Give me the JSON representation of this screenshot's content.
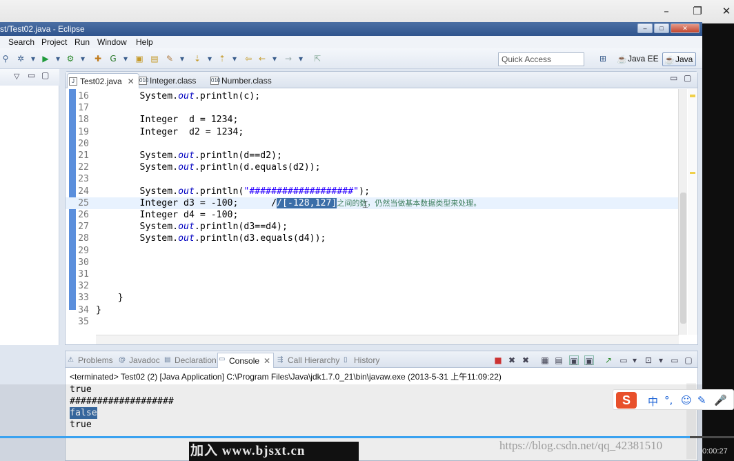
{
  "player": {
    "minimize_icon": "minimize-icon",
    "restore_icon": "restore-icon",
    "close_icon": "close-icon",
    "time": "0:00:27",
    "progress": 0.94
  },
  "window": {
    "title": "st/Test02.java - Eclipse"
  },
  "menu": [
    "Search",
    "Project",
    "Run",
    "Window",
    "Help"
  ],
  "toolbar": {
    "quick_access": "Quick Access",
    "perspectives": [
      "Java EE",
      "Java"
    ]
  },
  "editor": {
    "tabs": [
      {
        "label": "Test02.java",
        "active": true
      },
      {
        "label": "Integer.class",
        "active": false
      },
      {
        "label": "Number.class",
        "active": false
      }
    ],
    "lines": [
      {
        "n": "16",
        "c": "        System.<i>out</i>.println(c);"
      },
      {
        "n": "17",
        "c": ""
      },
      {
        "n": "18",
        "c": "        Integer  d = 1234;"
      },
      {
        "n": "19",
        "c": "        Integer  d2 = 1234;"
      },
      {
        "n": "20",
        "c": ""
      },
      {
        "n": "21",
        "c": "        System.<i>out</i>.println(d==d2);"
      },
      {
        "n": "22",
        "c": "        System.<i>out</i>.println(d.equals(d2));"
      },
      {
        "n": "23",
        "c": ""
      },
      {
        "n": "24",
        "c": "        System.<i>out</i>.println(<span class=\"str\">\"###################\"</span>);"
      },
      {
        "n": "25",
        "c": "        Integer d3 = -100;      /<span class=\"hl\">/[-128,127]</span><span class=\"cmt\">之间的数，仍然当做基本数据类型来处理。</span>",
        "cur": true
      },
      {
        "n": "26",
        "c": "        Integer d4 = -100;"
      },
      {
        "n": "27",
        "c": "        System.<i>out</i>.println(d3==d4);"
      },
      {
        "n": "28",
        "c": "        System.<i>out</i>.println(d3.equals(d4));"
      },
      {
        "n": "29",
        "c": ""
      },
      {
        "n": "30",
        "c": ""
      },
      {
        "n": "31",
        "c": ""
      },
      {
        "n": "32",
        "c": ""
      },
      {
        "n": "33",
        "c": "    }"
      },
      {
        "n": "34",
        "c": "}"
      },
      {
        "n": "35",
        "c": ""
      }
    ]
  },
  "console": {
    "tabs": [
      {
        "label": "Problems",
        "icon": "problems-icon"
      },
      {
        "label": "Javadoc",
        "icon": "javadoc-icon"
      },
      {
        "label": "Declaration",
        "icon": "declaration-icon"
      },
      {
        "label": "Console",
        "icon": "console-icon",
        "active": true
      },
      {
        "label": "Call Hierarchy",
        "icon": "call-hierarchy-icon"
      },
      {
        "label": "History",
        "icon": "history-icon"
      }
    ],
    "terminated": "<terminated> Test02 (2) [Java Application] C:\\Program Files\\Java\\jdk1.7.0_21\\bin\\javaw.exe (2013-5-31 上午11:09:22)",
    "output": [
      "true",
      "###################",
      "false",
      "true"
    ]
  },
  "ime": {
    "logo": "S",
    "items": [
      "中",
      "°,",
      "☺",
      "✎",
      "🎤"
    ]
  },
  "watermarks": {
    "bjsxt": "加入 www.bjsxt.cn",
    "csdn": "https://blog.csdn.net/qq_42381510"
  }
}
